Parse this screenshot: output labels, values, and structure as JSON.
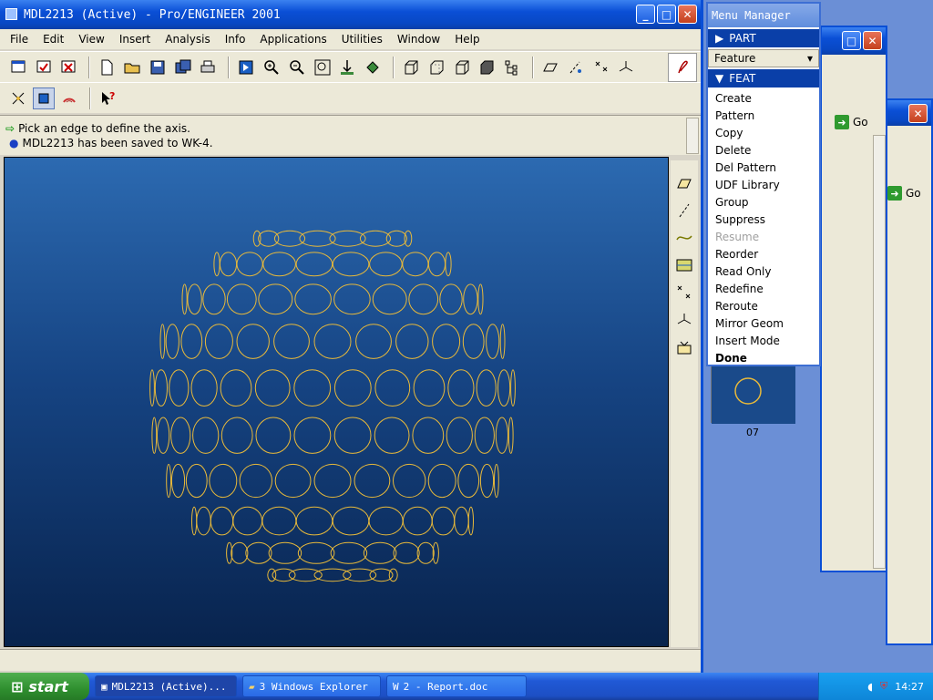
{
  "main_window": {
    "title": "MDL2213 (Active) - Pro/ENGINEER 2001",
    "menus": [
      {
        "label": "File"
      },
      {
        "label": "Edit"
      },
      {
        "label": "View"
      },
      {
        "label": "Insert"
      },
      {
        "label": "Analysis"
      },
      {
        "label": "Info"
      },
      {
        "label": "Applications"
      },
      {
        "label": "Utilities"
      },
      {
        "label": "Window"
      },
      {
        "label": "Help"
      }
    ],
    "messages": [
      {
        "icon": "arrow-icon",
        "text": "Pick an edge to define the axis."
      },
      {
        "icon": "info-dot-icon",
        "text": "MDL2213 has been saved to WK-4."
      }
    ],
    "colors": {
      "model_curves": "#e8b93a",
      "viewport_top": "#2c6ab1",
      "viewport_bottom": "#08234d"
    }
  },
  "menu_manager": {
    "title": "Menu Manager",
    "part_label": "PART",
    "dropdown_label": "Feature",
    "feat_label": "FEAT",
    "items": [
      {
        "label": "Create",
        "state": "normal"
      },
      {
        "label": "Pattern",
        "state": "normal"
      },
      {
        "label": "Copy",
        "state": "normal"
      },
      {
        "label": "Delete",
        "state": "normal"
      },
      {
        "label": "Del Pattern",
        "state": "normal"
      },
      {
        "label": "UDF Library",
        "state": "normal"
      },
      {
        "label": "Group",
        "state": "normal"
      },
      {
        "label": "Suppress",
        "state": "normal"
      },
      {
        "label": "Resume",
        "state": "disabled"
      },
      {
        "label": "Reorder",
        "state": "normal"
      },
      {
        "label": "Read Only",
        "state": "normal"
      },
      {
        "label": "Redefine",
        "state": "normal"
      },
      {
        "label": "Reroute",
        "state": "normal"
      },
      {
        "label": "Mirror Geom",
        "state": "normal"
      },
      {
        "label": "Insert Mode",
        "state": "normal"
      },
      {
        "label": "Done",
        "state": "bold"
      }
    ]
  },
  "background_window": {
    "go_label": "Go",
    "go_label_2": "Go",
    "thumbnail_label": "07"
  },
  "taskbar": {
    "start_label": "start",
    "tasks": [
      {
        "label": "MDL2213 (Active)...",
        "active": true
      },
      {
        "label": "3 Windows Explorer",
        "active": false
      },
      {
        "label": "2 - Report.doc",
        "active": false
      }
    ],
    "clock": "14:27"
  }
}
